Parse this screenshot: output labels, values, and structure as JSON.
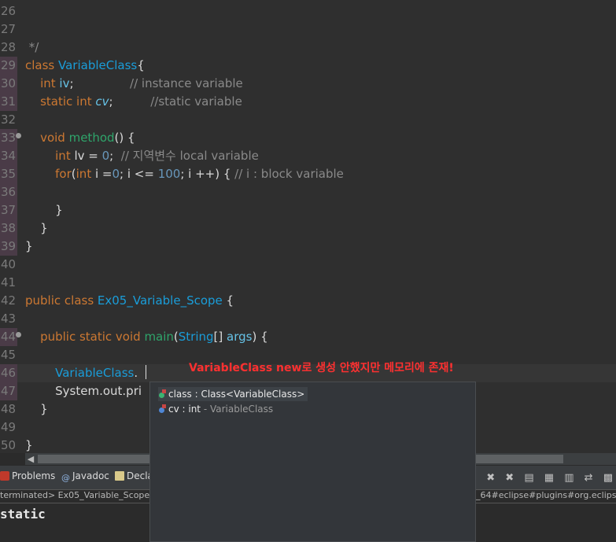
{
  "editor": {
    "lines": [
      {
        "n": "26",
        "segs": []
      },
      {
        "n": "27",
        "segs": []
      },
      {
        "n": "28",
        "segs": [
          {
            "t": " */",
            "c": "cmt"
          }
        ]
      },
      {
        "n": "29",
        "segs": [
          {
            "t": "class ",
            "c": "kw"
          },
          {
            "t": "VariableClass",
            "c": "cls"
          },
          {
            "t": "{",
            "c": ""
          }
        ]
      },
      {
        "n": "30",
        "segs": [
          {
            "t": "    int ",
            "c": "kw"
          },
          {
            "t": "iv",
            "c": "fld"
          },
          {
            "t": ";               ",
            "c": ""
          },
          {
            "t": "// instance variable",
            "c": "cmt"
          }
        ]
      },
      {
        "n": "31",
        "segs": [
          {
            "t": "    static int ",
            "c": "kw"
          },
          {
            "t": "cv",
            "c": "fld ital"
          },
          {
            "t": ";          ",
            "c": ""
          },
          {
            "t": "//static variable",
            "c": "cmt"
          }
        ]
      },
      {
        "n": "32",
        "segs": []
      },
      {
        "n": "33",
        "segs": [
          {
            "t": "    void ",
            "c": "kw"
          },
          {
            "t": "method",
            "c": "meth"
          },
          {
            "t": "() {",
            "c": ""
          }
        ]
      },
      {
        "n": "34",
        "segs": [
          {
            "t": "        int ",
            "c": "kw"
          },
          {
            "t": "lv",
            "c": ""
          },
          {
            "t": " = ",
            "c": ""
          },
          {
            "t": "0",
            "c": "num"
          },
          {
            "t": ";  ",
            "c": ""
          },
          {
            "t": "// 지역변수 local variable",
            "c": "cmt"
          }
        ]
      },
      {
        "n": "35",
        "segs": [
          {
            "t": "        for",
            "c": "kw"
          },
          {
            "t": "(",
            "c": ""
          },
          {
            "t": "int ",
            "c": "kw"
          },
          {
            "t": "i =",
            "c": ""
          },
          {
            "t": "0",
            "c": "num"
          },
          {
            "t": "; i <= ",
            "c": ""
          },
          {
            "t": "100",
            "c": "num"
          },
          {
            "t": "; i ++) { ",
            "c": ""
          },
          {
            "t": "// i : block variable",
            "c": "cmt"
          }
        ]
      },
      {
        "n": "36",
        "segs": []
      },
      {
        "n": "37",
        "segs": [
          {
            "t": "        }",
            "c": ""
          }
        ]
      },
      {
        "n": "38",
        "segs": [
          {
            "t": "    }",
            "c": ""
          }
        ]
      },
      {
        "n": "39",
        "segs": [
          {
            "t": "}",
            "c": ""
          }
        ]
      },
      {
        "n": "40",
        "segs": []
      },
      {
        "n": "41",
        "segs": []
      },
      {
        "n": "42",
        "segs": [
          {
            "t": "public class ",
            "c": "kw"
          },
          {
            "t": "Ex05_Variable_Scope",
            "c": "cls"
          },
          {
            "t": " {",
            "c": ""
          }
        ]
      },
      {
        "n": "43",
        "segs": []
      },
      {
        "n": "44",
        "segs": [
          {
            "t": "    public static void ",
            "c": "kw"
          },
          {
            "t": "main",
            "c": "meth"
          },
          {
            "t": "(",
            "c": ""
          },
          {
            "t": "String",
            "c": "cls"
          },
          {
            "t": "[] ",
            "c": ""
          },
          {
            "t": "args",
            "c": "fld"
          },
          {
            "t": ") {",
            "c": ""
          }
        ]
      },
      {
        "n": "45",
        "segs": []
      },
      {
        "n": "46",
        "segs": [
          {
            "t": "        VariableClass",
            "c": "cls"
          },
          {
            "t": ".",
            "c": ""
          }
        ]
      },
      {
        "n": "47",
        "segs": [
          {
            "t": "        System.out.pri",
            "c": ""
          }
        ]
      },
      {
        "n": "48",
        "segs": [
          {
            "t": "    }",
            "c": ""
          }
        ]
      },
      {
        "n": "49",
        "segs": []
      },
      {
        "n": "50",
        "segs": [
          {
            "t": "}",
            "c": ""
          }
        ]
      }
    ],
    "annotation": "VariableClass new로 생성 안했지만 메모리에 존재!"
  },
  "autocomplete": {
    "items": [
      {
        "label": "class : Class<VariableClass>",
        "sub": "",
        "icon": "public-field-icon",
        "dot": "#3cb371"
      },
      {
        "label": "cv : int",
        "sub": " - VariableClass",
        "icon": "static-field-icon",
        "dot": "#4f87d6"
      }
    ]
  },
  "panel": {
    "tabs": [
      {
        "label": "Problems",
        "icon": "problems-icon"
      },
      {
        "label": "Javadoc",
        "icon": "javadoc-icon"
      },
      {
        "label": "Decla",
        "icon": "declaration-icon"
      }
    ],
    "status_left": "terminated> Ex05_Variable_Scope [J",
    "status_right": "_64#eclipse#plugins#org.eclipse",
    "console_output": "static"
  },
  "colors": {
    "annotation": "#ff3030",
    "background": "#2f2f2f"
  }
}
